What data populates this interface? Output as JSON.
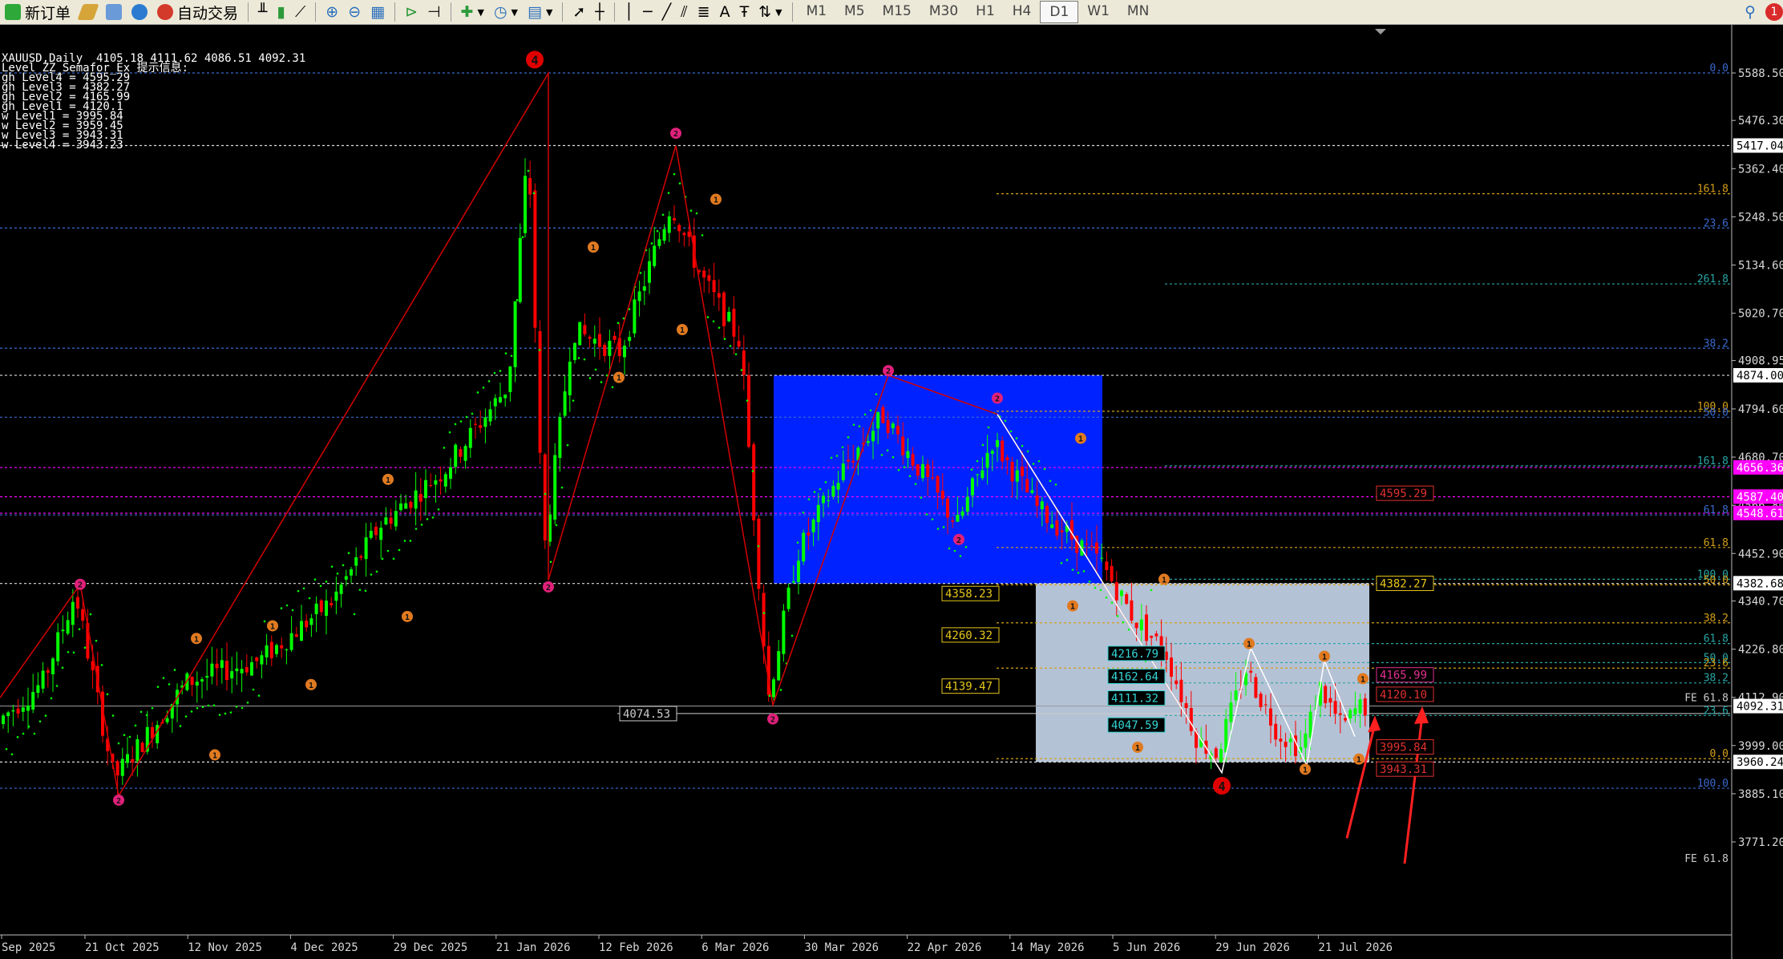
{
  "toolbar": {
    "new_order_label": "新订单",
    "auto_trade_label": "自动交易",
    "timeframes": [
      "M1",
      "M5",
      "M15",
      "M30",
      "H1",
      "H4",
      "D1",
      "W1",
      "MN"
    ],
    "active_timeframe": "D1",
    "text_tool_label": "A",
    "notification_count": "1"
  },
  "chart_header": {
    "title": "XAUUSD,Daily  4105.18 4111.62 4086.51 4092.31",
    "indicator": "Level_ZZ_Semafor_Ex 提示信息:",
    "levels": [
      "gh Level4 = 4595.29",
      "gh Level3 = 4382.27",
      "gh Level2 = 4165.99",
      "gh Level1 = 4120.1",
      "",
      "w Level1 = 3995.84",
      "w Level2 = 3959.45",
      "w Level3 = 3943.31",
      "w Level4 = 3943.23"
    ]
  },
  "chart_data": {
    "type": "candlestick",
    "symbol": "XAUUSD",
    "timeframe": "Daily",
    "last_price": 4092.31,
    "ylim": [
      3720,
      5650
    ],
    "y_axis_ticks": [
      5588.5,
      5476.3,
      5362.4,
      5248.5,
      5134.6,
      5020.7,
      4908.95,
      4794.6,
      4680.7,
      4566.8,
      4452.9,
      4340.7,
      4226.8,
      4112.9,
      3999.0,
      3885.1,
      3771.2
    ],
    "x_axis_labels": [
      "Sep 2025",
      "21 Oct 2025",
      "12 Nov 2025",
      "4 Dec 2025",
      "29 Dec 2025",
      "21 Jan 2026",
      "12 Feb 2026",
      "6 Mar 2026",
      "30 Mar 2026",
      "22 Apr 2026",
      "14 May 2026",
      "5 Jun 2026",
      "29 Jun 2026",
      "21 Jul 2026"
    ],
    "price_tags": [
      {
        "price": 5417.04,
        "label": "5417.04",
        "bg": "#ffffff",
        "fg": "#000000"
      },
      {
        "price": 4874.0,
        "label": "4874.00",
        "bg": "#ffffff",
        "fg": "#000000"
      },
      {
        "price": 4656.36,
        "label": "4656.36",
        "bg": "#ff00ff",
        "fg": "#ffffff"
      },
      {
        "price": 4587.4,
        "label": "4587.40",
        "bg": "#ff00ff",
        "fg": "#ffffff"
      },
      {
        "price": 4548.61,
        "label": "4548.61",
        "bg": "#ff00ff",
        "fg": "#ffffff"
      },
      {
        "price": 4382.68,
        "label": "4382.68",
        "bg": "#ffffff",
        "fg": "#000000"
      },
      {
        "price": 4092.31,
        "label": "4092.31",
        "bg": "#ffffff",
        "fg": "#000000"
      },
      {
        "price": 3960.24,
        "label": "3960.24",
        "bg": "#ffffff",
        "fg": "#000000"
      }
    ],
    "chart_labels": [
      {
        "text": "4358.23",
        "price": 4358.23,
        "color": "#e6c619"
      },
      {
        "text": "4260.32",
        "price": 4260.32,
        "color": "#e6c619"
      },
      {
        "text": "4139.47",
        "price": 4139.47,
        "color": "#e6c619"
      },
      {
        "text": "4074.53",
        "price": 4074.53,
        "color": "#cccccc"
      },
      {
        "text": "4382.27",
        "price": 4382.27,
        "color": "#e6c619"
      },
      {
        "text": "4595.29",
        "price": 4595.29,
        "color": "#e23030"
      },
      {
        "text": "4165.99",
        "price": 4165.99,
        "color": "#e23090"
      },
      {
        "text": "4120.10",
        "price": 4120.1,
        "color": "#e23030"
      },
      {
        "text": "4216.79",
        "price": 4216.79,
        "color": "#34d5d5"
      },
      {
        "text": "4162.64",
        "price": 4162.64,
        "color": "#34d5d5"
      },
      {
        "text": "4111.32",
        "price": 4111.32,
        "color": "#34d5d5"
      },
      {
        "text": "4047.59",
        "price": 4047.59,
        "color": "#34d5d5"
      },
      {
        "text": "3995.84",
        "price": 3995.84,
        "color": "#e23030"
      },
      {
        "text": "3943.31",
        "price": 3943.31,
        "color": "#e23030"
      }
    ],
    "fib_right_labels": [
      {
        "text": "0.0",
        "price": 5588.5,
        "color": "#3a6ad0"
      },
      {
        "text": "161.8",
        "price": 5303,
        "color": "#d4a017"
      },
      {
        "text": "23.6",
        "price": 5222,
        "color": "#3a6ad0"
      },
      {
        "text": "261.8",
        "price": 5090,
        "color": "#2aa7a7"
      },
      {
        "text": "38.2",
        "price": 4938,
        "color": "#3a6ad0"
      },
      {
        "text": "100.0",
        "price": 4789,
        "color": "#d4a017"
      },
      {
        "text": "50.0",
        "price": 4775,
        "color": "#3a6ad0"
      },
      {
        "text": "161.8",
        "price": 4660,
        "color": "#2aa7a7"
      },
      {
        "text": "61.8",
        "price": 4544,
        "color": "#3a6ad0"
      },
      {
        "text": "61.8",
        "price": 4467,
        "color": "#d4a017"
      },
      {
        "text": "100.0",
        "price": 4392,
        "color": "#2aa7a7"
      },
      {
        "text": "50.0",
        "price": 4379,
        "color": "#d4a017"
      },
      {
        "text": "38.2",
        "price": 4289,
        "color": "#d4a017"
      },
      {
        "text": "61.8",
        "price": 4240,
        "color": "#2aa7a7"
      },
      {
        "text": "50.0",
        "price": 4195,
        "color": "#2aa7a7"
      },
      {
        "text": "23.6",
        "price": 4182,
        "color": "#d4a017"
      },
      {
        "text": "38.2",
        "price": 4147,
        "color": "#2aa7a7"
      },
      {
        "text": "FE 61.8",
        "price": 4100,
        "color": "#cccccc"
      },
      {
        "text": "23.6",
        "price": 4070,
        "color": "#2aa7a7"
      },
      {
        "text": "0.0",
        "price": 3968,
        "color": "#d4a017"
      },
      {
        "text": "100.0",
        "price": 3898,
        "color": "#3a6ad0"
      },
      {
        "text": "FE 61.8",
        "price": 3720,
        "color": "#cccccc"
      }
    ],
    "semafor_markers": [
      {
        "label": "4",
        "x": 667,
        "price": 5620,
        "color": "#e00000",
        "size": "big"
      },
      {
        "label": "4",
        "x": 1524,
        "price": 3904,
        "color": "#e00000",
        "size": "big"
      },
      {
        "label": "2",
        "x": 100,
        "price": 4380,
        "color": "#e0207a"
      },
      {
        "label": "2",
        "x": 148,
        "price": 3870,
        "color": "#e0207a"
      },
      {
        "label": "2",
        "x": 684,
        "price": 4374,
        "color": "#e0207a"
      },
      {
        "label": "2",
        "x": 843,
        "price": 5446,
        "color": "#e0207a"
      },
      {
        "label": "2",
        "x": 964,
        "price": 4062,
        "color": "#e0207a"
      },
      {
        "label": "2",
        "x": 1108,
        "price": 4885,
        "color": "#e0207a"
      },
      {
        "label": "2",
        "x": 1244,
        "price": 4820,
        "color": "#e0207a"
      },
      {
        "label": "2",
        "x": 1196,
        "price": 4486,
        "color": "#e0207a"
      },
      {
        "label": "1",
        "x": 484,
        "price": 4628,
        "color": "#e07a20"
      },
      {
        "label": "1",
        "x": 245,
        "price": 4252,
        "color": "#e07a20"
      },
      {
        "label": "1",
        "x": 340,
        "price": 4282,
        "color": "#e07a20"
      },
      {
        "label": "1",
        "x": 508,
        "price": 4304,
        "color": "#e07a20"
      },
      {
        "label": "1",
        "x": 388,
        "price": 4143,
        "color": "#e07a20"
      },
      {
        "label": "1",
        "x": 268,
        "price": 3977,
        "color": "#e07a20"
      },
      {
        "label": "1",
        "x": 740,
        "price": 5177,
        "color": "#e07a20"
      },
      {
        "label": "1",
        "x": 893,
        "price": 5290,
        "color": "#e07a20"
      },
      {
        "label": "1",
        "x": 851,
        "price": 4982,
        "color": "#e07a20"
      },
      {
        "label": "1",
        "x": 772,
        "price": 4869,
        "color": "#e07a20"
      },
      {
        "label": "1",
        "x": 1348,
        "price": 4725,
        "color": "#e07a20"
      },
      {
        "label": "1",
        "x": 1338,
        "price": 4329,
        "color": "#e07a20"
      },
      {
        "label": "1",
        "x": 1452,
        "price": 4392,
        "color": "#e07a20"
      },
      {
        "label": "1",
        "x": 1419,
        "price": 3995,
        "color": "#e07a20"
      },
      {
        "label": "1",
        "x": 1558,
        "price": 4240,
        "color": "#e07a20"
      },
      {
        "label": "1",
        "x": 1652,
        "price": 4210,
        "color": "#e07a20"
      },
      {
        "label": "1",
        "x": 1700,
        "price": 4157,
        "color": "#e07a20"
      },
      {
        "label": "1",
        "x": 1628,
        "price": 3943,
        "color": "#e07a20"
      },
      {
        "label": "1",
        "x": 1695,
        "price": 3967,
        "color": "#e07a20"
      }
    ],
    "zones": [
      {
        "name": "blue-zone",
        "price_top": 4874,
        "price_bottom": 4382,
        "color": "#0022ff"
      },
      {
        "name": "gray-zone",
        "price_top": 4382,
        "price_bottom": 3960,
        "color": "#b4c2d6"
      }
    ],
    "zigzag_points": [
      [
        0,
        4112
      ],
      [
        100,
        4380
      ],
      [
        148,
        3880
      ],
      [
        684,
        4390
      ],
      [
        667,
        5588
      ],
      [
        843,
        5417
      ],
      [
        964,
        4095
      ],
      [
        1108,
        4874
      ],
      [
        1244,
        4782
      ],
      [
        1524,
        3935
      ],
      [
        1560,
        4230
      ],
      [
        1630,
        3952
      ],
      [
        1652,
        4200
      ],
      [
        1690,
        4020
      ]
    ],
    "candles_sampled_from": "Sep 2025 – Jul 2026"
  }
}
